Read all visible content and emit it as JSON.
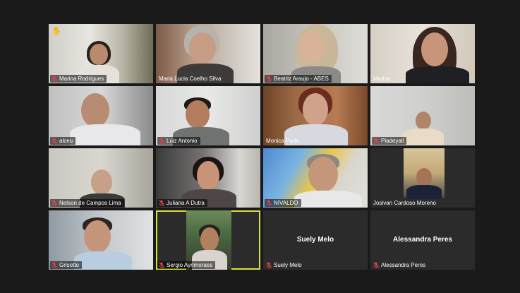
{
  "participants": [
    {
      "name": "Marina Rodrigues",
      "muted": true,
      "hand_raised": true
    },
    {
      "name": "Maria Lucia Coelho Silva",
      "muted": false
    },
    {
      "name": "Beatriz Araujo - ABES",
      "muted": true
    },
    {
      "name": "Marisa",
      "muted": false
    },
    {
      "name": "alceu",
      "muted": true
    },
    {
      "name": "Luiz Antonio",
      "muted": true
    },
    {
      "name": "Monica Porto",
      "muted": false
    },
    {
      "name": "Piadeyall",
      "muted": true
    },
    {
      "name": "Nelson de Campos Lima",
      "muted": true
    },
    {
      "name": "Juliana A Dutra",
      "muted": true
    },
    {
      "name": "NIVALDO",
      "muted": true
    },
    {
      "name": "Josivan Cardoso Moreno",
      "muted": false
    },
    {
      "name": "Grisotto",
      "muted": true
    },
    {
      "name": "Sergio Ayrimoraes",
      "muted": true,
      "active_speaker": true
    },
    {
      "name": "Suely Melo",
      "muted": true,
      "video_off": true,
      "display_name": "Suely Melo"
    },
    {
      "name": "Alessandra Peres",
      "muted": true,
      "video_off": true,
      "display_name": "Alessandra Peres"
    }
  ],
  "icons": {
    "mic_muted": "mic-muted-icon",
    "raised_hand": "raised-hand-icon"
  },
  "colors": {
    "background": "#1a1a1a",
    "active_speaker_border": "#d8e33a",
    "mic_muted": "#e0414a"
  }
}
